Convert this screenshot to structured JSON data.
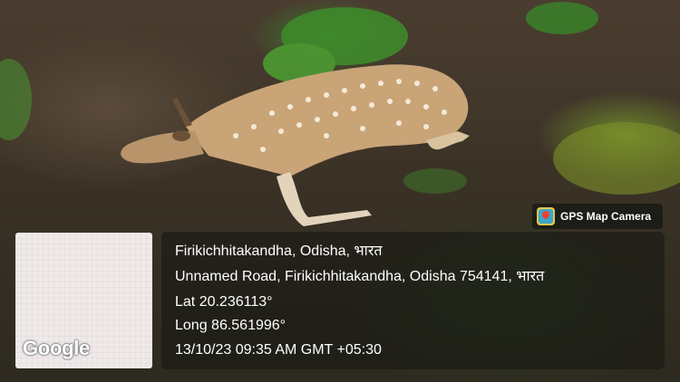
{
  "photo": {
    "subject": "deer lying on forest floor"
  },
  "badge": {
    "icon": "gps-map-camera-icon",
    "label": "GPS Map Camera"
  },
  "map": {
    "logo_text": "Google"
  },
  "location": {
    "title": "Firikichhitakandha, Odisha, भारत",
    "address": "Unnamed Road, Firikichhitakandha, Odisha 754141, भारत",
    "lat": "Lat 20.236113°",
    "long": "Long 86.561996°",
    "datetime": "13/10/23 09:35 AM GMT +05:30"
  }
}
